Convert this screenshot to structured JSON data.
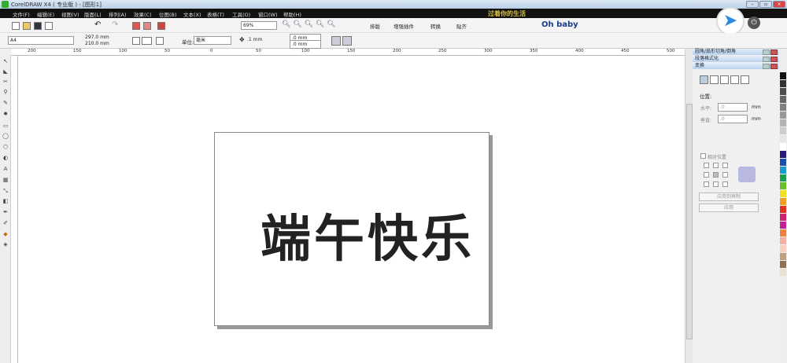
{
  "window": {
    "title": "CorelDRAW X4 ( 专业版 ) - [图形1]",
    "banner": "过着你的生活",
    "brand_text": "Oh baby"
  },
  "menu": [
    "文件(F)",
    "编辑(E)",
    "视图(V)",
    "版面(L)",
    "排列(A)",
    "效果(C)",
    "位图(B)",
    "文本(X)",
    "表格(T)",
    "工具(O)",
    "窗口(W)",
    "帮助(H)"
  ],
  "toolbar": {
    "zoom": "69%",
    "buttons": [
      "排版",
      "增强插件",
      "转换",
      "贴齐"
    ]
  },
  "propbar": {
    "paper": "A4",
    "width": "297.0 mm",
    "height": "210.0 mm",
    "unit_label": "单位:",
    "unit": "毫米",
    "nudge": ".1 mm",
    "dup_x": ".0 mm",
    "dup_y": ".0 mm"
  },
  "ruler": {
    "labels": [
      "200",
      "150",
      "100",
      "50",
      "0",
      "50",
      "100",
      "150",
      "200",
      "250",
      "300",
      "350",
      "400",
      "450",
      "500"
    ],
    "unit": "毫米"
  },
  "canvas": {
    "text": "端午快乐"
  },
  "docker": {
    "headers": [
      "圆角/扇形切角/倒角",
      "段落格式化",
      "变换"
    ],
    "position_label": "位置:",
    "h_label": "水平:",
    "v_label": "垂直:",
    "h_value": ".0",
    "v_value": ".0",
    "unit": "mm",
    "relative": "相对位置",
    "apply_copy": "应用到再制",
    "apply": "应用"
  },
  "palette": [
    "#111111",
    "#333333",
    "#4d4d4d",
    "#666666",
    "#808080",
    "#999999",
    "#b3b3b3",
    "#cccccc",
    "#e6e6e6",
    "#ffffff",
    "#2a1a7a",
    "#1a4fb0",
    "#1a9ad0",
    "#1aa050",
    "#6dbf2a",
    "#f0e020",
    "#f0a020",
    "#e03020",
    "#d02070",
    "#c02090",
    "#f08040",
    "#f4b0a0",
    "#f8d0c0",
    "#c0a080",
    "#907050",
    "#e8e0d0"
  ]
}
